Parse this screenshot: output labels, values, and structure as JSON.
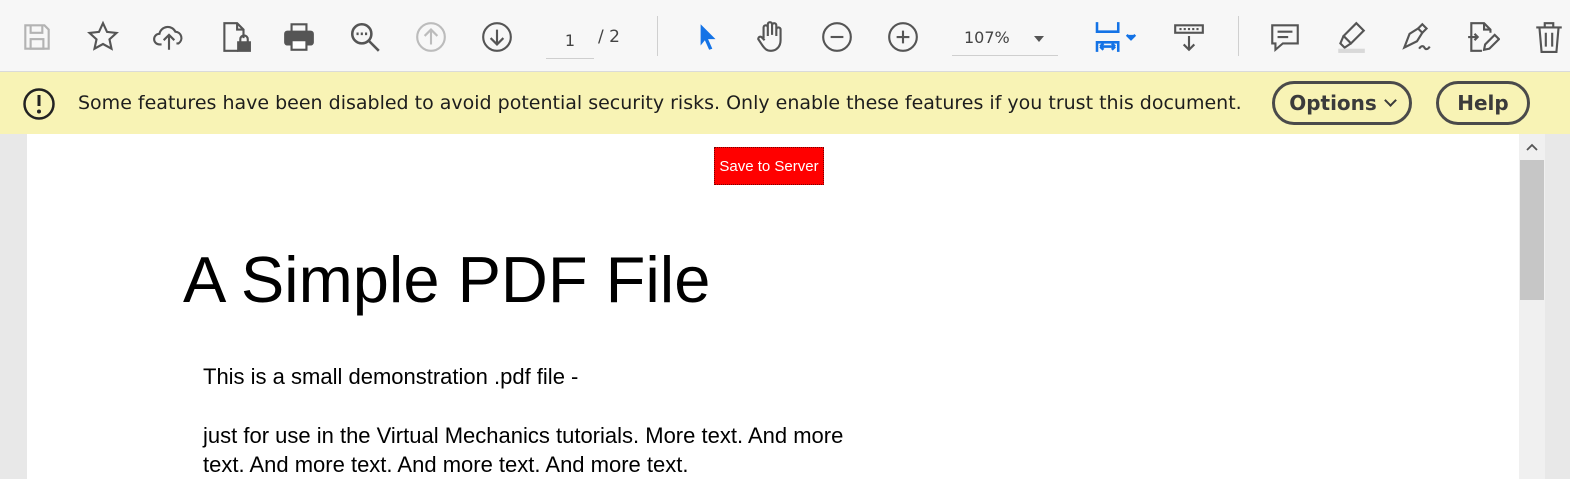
{
  "toolbar": {
    "page_current": "1",
    "page_total": "/ 2",
    "zoom": "107%",
    "icons": [
      "save-icon",
      "bookmark-star-icon",
      "upload-cloud-icon",
      "protect-file-icon",
      "print-icon",
      "find-zoom-icon",
      "previous-page-icon",
      "next-page-icon",
      "select-cursor-icon",
      "hand-tool-icon",
      "zoom-out-icon",
      "zoom-in-icon",
      "fit-width-icon",
      "scrolling-mode-icon",
      "comment-icon",
      "highlight-icon",
      "sign-icon",
      "fill-edit-icon",
      "delete-icon"
    ],
    "accent_color": "#1473e6"
  },
  "banner": {
    "message": "Some features have been disabled to avoid potential security risks. Only enable these features if you trust this document.",
    "options_label": "Options",
    "help_label": "Help",
    "background": "#f8f3b5"
  },
  "document": {
    "save_button_label": "Save to Server",
    "save_button_color": "#ff0000",
    "title": "A Simple PDF File",
    "paragraph1": "This is a small demonstration .pdf file -",
    "paragraph2_line1": "just for use in the Virtual Mechanics tutorials. More text. And more",
    "paragraph2_line2": "text. And more text. And more text. And more text."
  }
}
